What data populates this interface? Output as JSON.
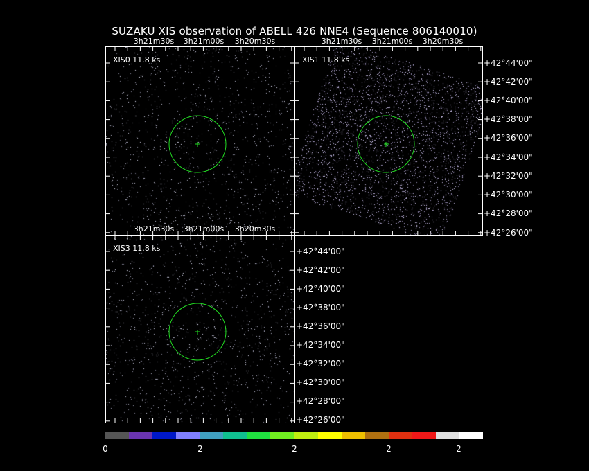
{
  "title": "SUZAKU XIS observation of ABELL 426 NNE4  (Sequence 806140010)",
  "panels": [
    {
      "label": "XIS0 11.8 ks",
      "density": "sparse"
    },
    {
      "label": "XIS1 11.8 ks",
      "density": "dense"
    },
    {
      "label": "XIS3 11.8 ks",
      "density": "sparse"
    }
  ],
  "ra_ticks": [
    "3h21m30s",
    "3h21m00s",
    "3h20m30s"
  ],
  "dec_ticks": [
    "+42°44'00\"",
    "+42°42'00\"",
    "+42°40'00\"",
    "+42°38'00\"",
    "+42°36'00\"",
    "+42°34'00\"",
    "+42°32'00\"",
    "+42°30'00\"",
    "+42°28'00\"",
    "+42°26'00\""
  ],
  "colorbar": {
    "colors": [
      "#555555",
      "#6a34b0",
      "#0018c8",
      "#8080ff",
      "#40a0c0",
      "#10c090",
      "#20e040",
      "#70f020",
      "#c0f010",
      "#ffff00",
      "#f0c000",
      "#b07010",
      "#e03010",
      "#f01818",
      "#e0e0e0",
      "#ffffff"
    ],
    "labels": [
      "0",
      "2",
      "2",
      "2",
      "2"
    ]
  },
  "region_color": "#22dd22"
}
